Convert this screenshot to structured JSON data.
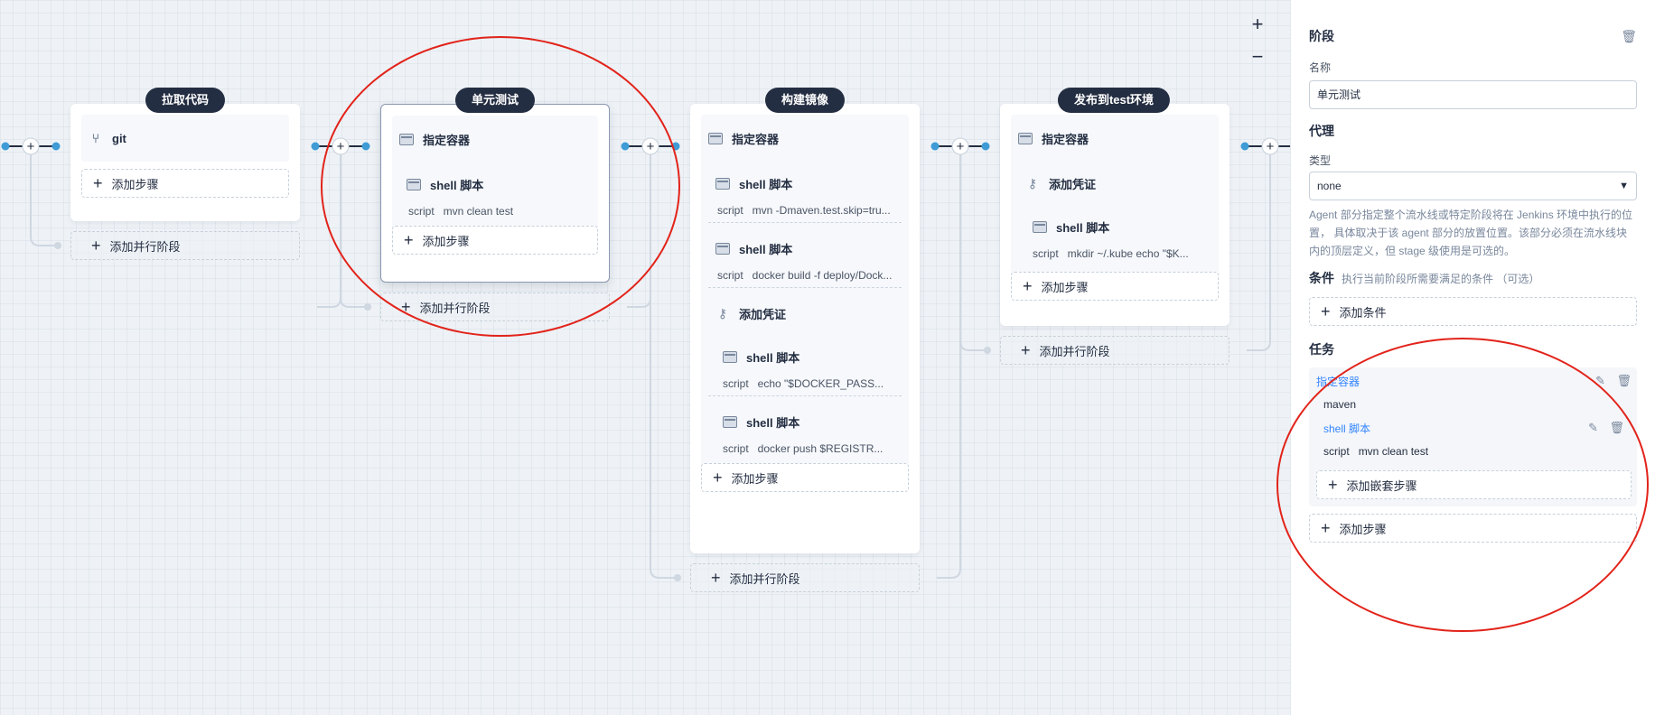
{
  "canvas": {
    "zoom_in": "+",
    "zoom_out": "−",
    "add_node_icon": "+",
    "stages": [
      {
        "name": "拉取代码",
        "tasks": [
          {
            "type": "git",
            "icon": "git-branch-icon",
            "label": "git"
          }
        ],
        "add_step": "添加步骤",
        "add_parallel": "添加并行阶段"
      },
      {
        "name": "单元测试",
        "tasks": [
          {
            "type": "container",
            "label": "指定容器"
          },
          {
            "type": "shell",
            "label": "shell 脚本",
            "script_kw": "script",
            "script": "mvn clean test"
          }
        ],
        "add_step": "添加步骤",
        "add_parallel": "添加并行阶段"
      },
      {
        "name": "构建镜像",
        "tasks": [
          {
            "type": "container",
            "label": "指定容器"
          },
          {
            "type": "shell",
            "label": "shell 脚本",
            "script_kw": "script",
            "script": "mvn -Dmaven.test.skip=tru..."
          },
          {
            "type": "shell",
            "label": "shell 脚本",
            "script_kw": "script",
            "script": "docker build -f deploy/Dock..."
          },
          {
            "type": "credential",
            "label": "添加凭证"
          },
          {
            "type": "shell",
            "label": "shell 脚本",
            "script_kw": "script",
            "script": "echo \"$DOCKER_PASS..."
          },
          {
            "type": "shell",
            "label": "shell 脚本",
            "script_kw": "script",
            "script": "docker push $REGISTR..."
          }
        ],
        "add_step": "添加步骤",
        "add_parallel": "添加并行阶段"
      },
      {
        "name": "发布到test环境",
        "tasks": [
          {
            "type": "container",
            "label": "指定容器"
          },
          {
            "type": "credential",
            "label": "添加凭证"
          },
          {
            "type": "shell",
            "label": "shell 脚本",
            "script_kw": "script",
            "script": "mkdir ~/.kube echo \"$K..."
          }
        ],
        "add_step": "添加步骤",
        "add_parallel": "添加并行阶段"
      }
    ]
  },
  "panel": {
    "title": "阶段",
    "name_label": "名称",
    "name_value": "单元测试",
    "agent_title": "代理",
    "type_label": "类型",
    "type_value": "none",
    "agent_desc": "Agent 部分指定整个流水线或特定阶段将在 Jenkins 环境中执行的位置， 具体取决于该 agent 部分的放置位置。该部分必须在流水线块内的顶层定义，但 stage 级使用是可选的。",
    "conditions_title": "条件",
    "conditions_hint": "执行当前阶段所需要满足的条件 （可选）",
    "add_condition": "添加条件",
    "tasks_title": "任务",
    "container_label": "指定容器",
    "container_value": "maven",
    "shell_label": "shell 脚本",
    "script_kw": "script",
    "script_value": "mvn clean test",
    "add_nested": "添加嵌套步骤",
    "add_step": "添加步骤"
  },
  "colors": {
    "header_bg": "#242e42",
    "accent_blue": "#3385ff",
    "node_blue": "#3e9bd6",
    "annotation_red": "#e2231a"
  }
}
